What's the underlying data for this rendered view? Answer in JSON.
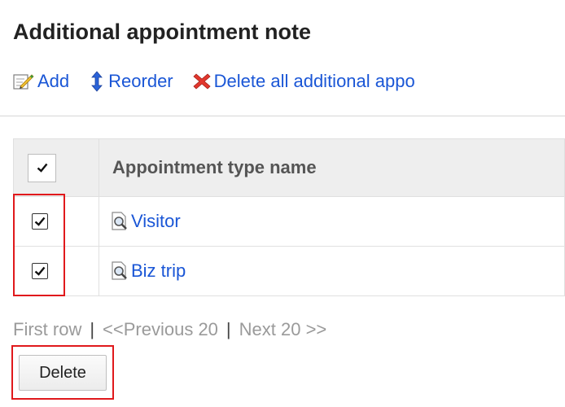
{
  "page": {
    "title": "Additional appointment note"
  },
  "toolbar": {
    "add_label": "Add",
    "reorder_label": "Reorder",
    "delete_all_label": "Delete all additional appo"
  },
  "table": {
    "column_header": "Appointment type name",
    "header_checked": true,
    "rows": [
      {
        "name": "Visitor",
        "checked": true
      },
      {
        "name": "Biz trip",
        "checked": true
      }
    ]
  },
  "pager": {
    "first": "First row",
    "separator": "|",
    "previous": "<<Previous 20",
    "next": "Next 20 >>"
  },
  "actions": {
    "delete_label": "Delete"
  },
  "colors": {
    "link": "#1a56d6",
    "highlight": "#e0191c",
    "disabled_text": "#9a9a9a",
    "header_bg": "#eeeeee"
  },
  "icons": {
    "add": "edit-pencil-icon",
    "reorder": "up-down-arrow-icon",
    "delete_all": "red-x-icon",
    "row": "magnifier-document-icon",
    "checkbox": "check-icon"
  }
}
